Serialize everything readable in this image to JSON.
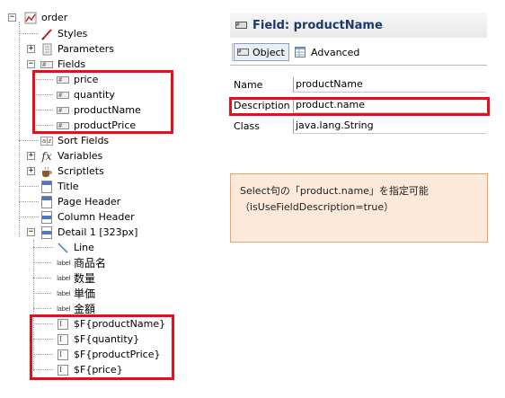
{
  "tree": {
    "root": "order",
    "styles": "Styles",
    "parameters": "Parameters",
    "fields": "Fields",
    "field_items": [
      "price",
      "quantity",
      "productName",
      "productPrice"
    ],
    "sort_fields": "Sort Fields",
    "variables": "Variables",
    "scriptlets": "Scriptlets",
    "title": "Title",
    "page_header": "Page Header",
    "column_header": "Column Header",
    "detail": "Detail 1 [323px]",
    "line": "Line",
    "label_icon_text": "label",
    "detail_labels": [
      "商品名",
      "数量",
      "単価",
      "金額"
    ],
    "detail_textfields": [
      "$F{productName}",
      "$F{quantity}",
      "$F{productPrice}",
      "$F{price}"
    ],
    "sort_icon_text": "a|z",
    "fx_icon_text": "fx"
  },
  "panel": {
    "title": "Field: productName",
    "tabs": {
      "object": "Object",
      "advanced": "Advanced"
    },
    "properties": [
      {
        "name": "Name",
        "value": "productName"
      },
      {
        "name": "Description",
        "value": "product.name"
      },
      {
        "name": "Class",
        "value": "java.lang.String"
      }
    ]
  },
  "note": {
    "line1": "Select句の「product.name」を指定可能",
    "line2": "（isUseFieldDescription=true）"
  },
  "colors": {
    "highlight": "#e3101b",
    "note_bg": "#fde9d9",
    "note_border": "#f2a35f",
    "title_text": "#1b3a6b"
  }
}
